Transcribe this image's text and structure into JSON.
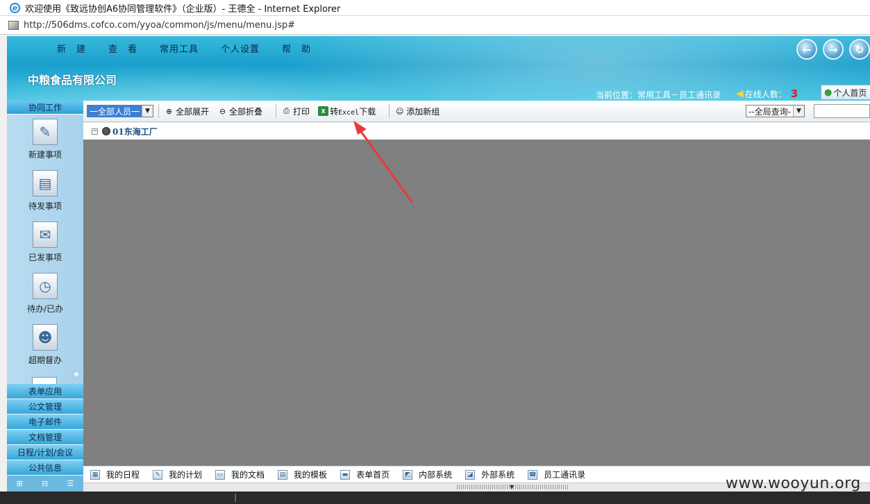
{
  "window": {
    "title": "欢迎使用《致远协创A6协同管理软件》（企业版）- 王德全 - Internet Explorer",
    "url": "http://506dms.cofco.com/yyoa/common/js/menu/menu.jsp#"
  },
  "header": {
    "menu": [
      "新　建",
      "查　看",
      "常用工具",
      "个人设置",
      "帮　助"
    ],
    "company": "中粮食品有限公司",
    "location": "当前位置：常用工具－员工通讯录",
    "online_label": "在线人数：",
    "online_count": "3",
    "home_label": "个人首页"
  },
  "sidebar": {
    "head": "协同工作",
    "items": [
      {
        "label": "新建事项",
        "icon": "new-item-icon"
      },
      {
        "label": "待发事项",
        "icon": "pending-send-icon"
      },
      {
        "label": "已发事项",
        "icon": "sent-item-icon"
      },
      {
        "label": "待办/已办",
        "icon": "todo-done-icon"
      },
      {
        "label": "超期督办",
        "icon": "overdue-icon"
      }
    ],
    "groups": [
      "表单应用",
      "公文管理",
      "电子邮件",
      "文档管理",
      "日程/计划/会议",
      "公共信息"
    ]
  },
  "toolbar": {
    "person_select": "一全部人员一",
    "expand_all": "全部展开",
    "collapse_all": "全部折叠",
    "print": "打印",
    "excel_pre": "转",
    "excel_mid": "Excel",
    "excel_post": "下载",
    "add_group": "添加新组",
    "global_select": "--全局查询-",
    "search_value": ""
  },
  "tree": {
    "root": "01东海工厂"
  },
  "bottom_bar": [
    {
      "label": "我的日程",
      "icon": "calendar-icon"
    },
    {
      "label": "我的计划",
      "icon": "plan-icon"
    },
    {
      "label": "我的文档",
      "icon": "document-icon"
    },
    {
      "label": "我的模板",
      "icon": "template-icon"
    },
    {
      "label": "表单首页",
      "icon": "form-home-icon"
    },
    {
      "label": "内部系统",
      "icon": "internal-system-icon"
    },
    {
      "label": "外部系统",
      "icon": "external-system-icon"
    },
    {
      "label": "员工通讯录",
      "icon": "contacts-icon"
    }
  ],
  "watermark": "www.wooyun.org",
  "colors": {
    "annotation_arrow": "#e83a3a",
    "banner": "#1a9fcc",
    "main_area": "#808080"
  }
}
